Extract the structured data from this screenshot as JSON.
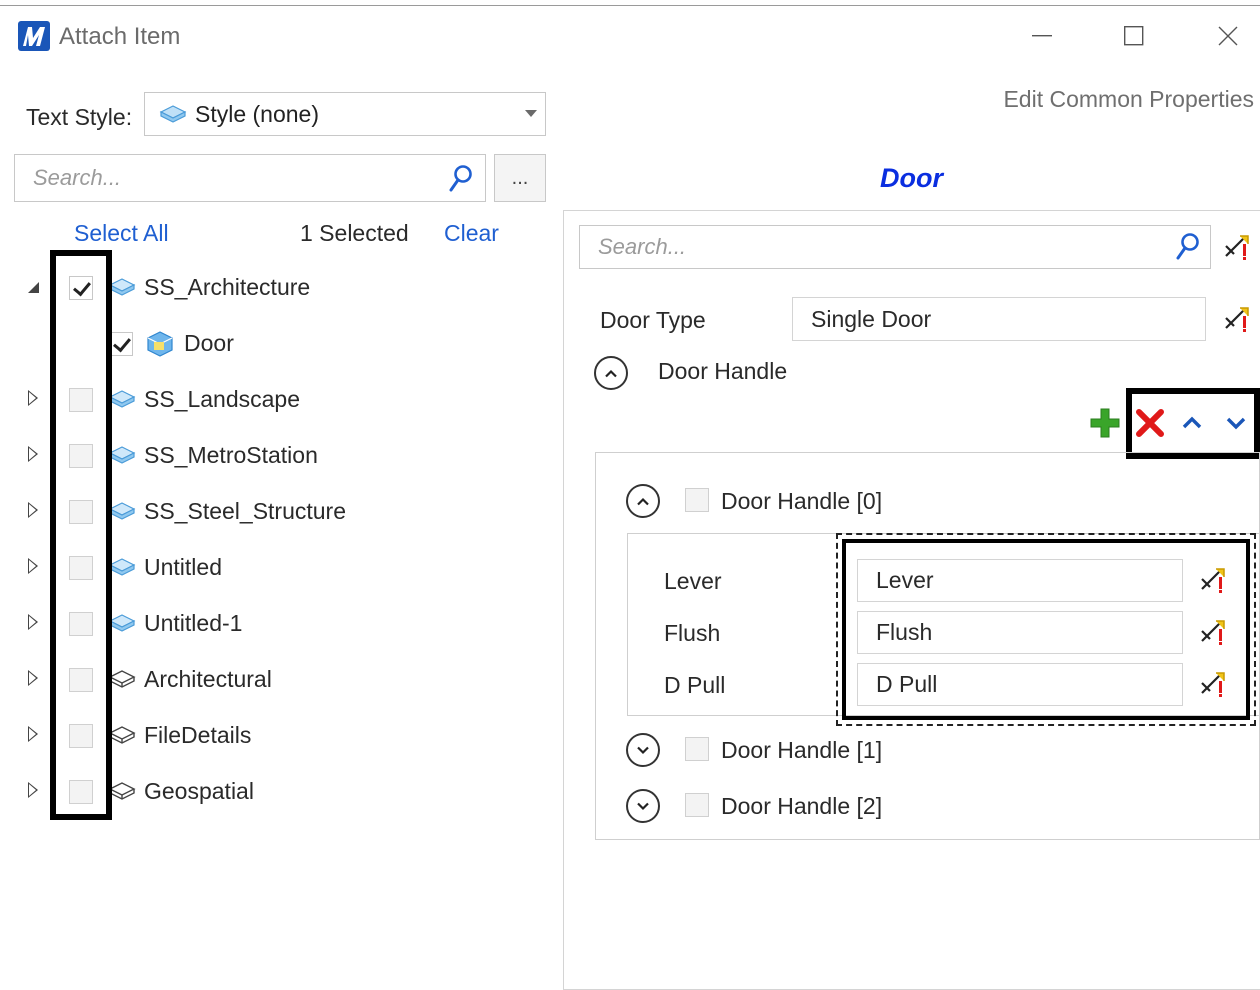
{
  "window": {
    "title": "Attach Item",
    "minimize": "—",
    "maximize": "□",
    "close": "✕"
  },
  "header": {
    "edit_common_properties": "Edit Common Properties"
  },
  "left": {
    "text_style_label": "Text Style:",
    "text_style_value": "Style (none)",
    "search_placeholder": "Search...",
    "ellipsis": "...",
    "select_all": "Select All",
    "selected_count": "1  Selected",
    "clear": "Clear",
    "tree": [
      {
        "label": "SS_Architecture",
        "expanded": true,
        "checked": true,
        "icon": "blue-schema-icon"
      },
      {
        "label": "Door",
        "child": true,
        "checked": true,
        "icon": "blue-class-icon"
      },
      {
        "label": "SS_Landscape",
        "checked": false,
        "icon": "blue-schema-icon"
      },
      {
        "label": "SS_MetroStation",
        "checked": false,
        "icon": "blue-schema-icon"
      },
      {
        "label": "SS_Steel_Structure",
        "checked": false,
        "icon": "blue-schema-icon"
      },
      {
        "label": "Untitled",
        "checked": false,
        "icon": "blue-schema-icon"
      },
      {
        "label": "Untitled-1",
        "checked": false,
        "icon": "blue-schema-icon"
      },
      {
        "label": "Architectural",
        "checked": false,
        "icon": "gray-schema-icon"
      },
      {
        "label": "FileDetails",
        "checked": false,
        "icon": "gray-schema-icon"
      },
      {
        "label": "Geospatial",
        "checked": false,
        "icon": "gray-schema-icon"
      }
    ]
  },
  "right": {
    "item_title": "Door",
    "search_placeholder": "Search...",
    "door_type_label": "Door Type",
    "door_type_value": "Single Door",
    "door_handle_label": "Door Handle",
    "groups": [
      {
        "label": "Door Handle [0]",
        "expanded": true
      },
      {
        "label": "Door Handle [1]",
        "expanded": false
      },
      {
        "label": "Door Handle [2]",
        "expanded": false
      }
    ],
    "props": [
      {
        "label": "Lever",
        "value": "Lever"
      },
      {
        "label": "Flush",
        "value": "Flush"
      },
      {
        "label": "D Pull",
        "value": "D Pull"
      }
    ]
  },
  "colors": {
    "link": "#1f5fd1",
    "title_blue": "#0a2ee0",
    "add_green": "#3aa52a",
    "delete_red": "#e01919",
    "arrow_blue": "#1a56b8"
  }
}
